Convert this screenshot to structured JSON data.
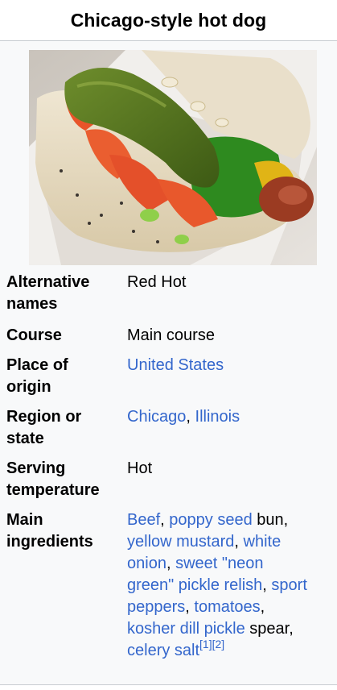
{
  "infobox": {
    "title": "Chicago-style hot dog",
    "image_alt": "Chicago-style hot dog photo"
  },
  "rows": {
    "alternative_names": {
      "label_1": "Alternative",
      "label_2": "names",
      "value": "Red Hot"
    },
    "course": {
      "label": "Course",
      "value": "Main course"
    },
    "place_of_origin": {
      "label_1": "Place of",
      "label_2": "origin",
      "value": "United States"
    },
    "region": {
      "label_1": "Region or",
      "label_2": "state",
      "city": "Chicago",
      "sep": ", ",
      "state": "Illinois"
    },
    "serving_temperature": {
      "label_1": "Serving",
      "label_2": "temperature",
      "value": "Hot"
    },
    "main_ingredients": {
      "label_1": "Main",
      "label_2": "ingredients",
      "lines": {
        "l1": {
          "beef": "Beef",
          "comma1": ", ",
          "poppy_seed": "poppy seed",
          "bun": " bun,"
        },
        "l2": {
          "yellow_mustard": "yellow mustard",
          "comma2": ", ",
          "white": "white"
        },
        "l3": {
          "onion": "onion",
          "comma3": ", ",
          "sweet_neon": "sweet \"neon"
        },
        "l4": {
          "green_relish": "green\" pickle relish",
          "comma4": ", ",
          "sport": "sport"
        },
        "l5": {
          "peppers": "peppers",
          "comma5": ", ",
          "tomatoes": "tomatoes",
          "comma6": ","
        },
        "l6": {
          "kosher": "kosher dill pickle",
          "spear": " spear,"
        },
        "l7": {
          "celery": "celery salt",
          "ref1": "[1]",
          "ref2": "[2]"
        }
      }
    }
  },
  "colors": {
    "link": "#3366cc",
    "background": "#f8f9fa",
    "border": "#c8ccd1"
  }
}
